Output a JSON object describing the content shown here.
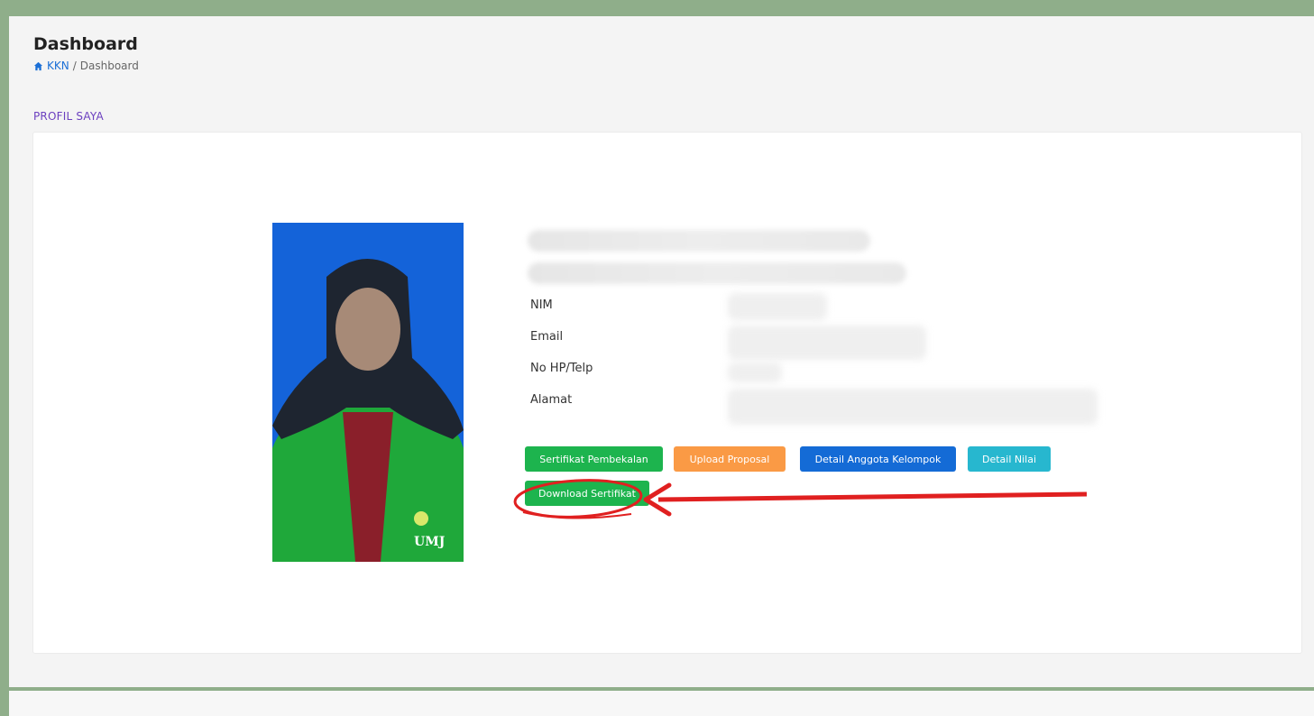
{
  "header": {
    "title": "Dashboard",
    "breadcrumb": {
      "root": "KKN",
      "separator": "/",
      "current": "Dashboard"
    }
  },
  "section": {
    "heading": "PROFIL SAYA"
  },
  "profile": {
    "photo_badge": "UMJ",
    "fields": [
      {
        "label": "NIM"
      },
      {
        "label": "Email"
      },
      {
        "label": "No HP/Telp"
      },
      {
        "label": "Alamat"
      }
    ]
  },
  "actions": {
    "sertifikat_pembekalan": "Sertifikat Pembekalan",
    "upload_proposal": "Upload Proposal",
    "detail_anggota": "Detail Anggota Kelompok",
    "detail_nilai": "Detail Nilai",
    "download_sertifikat": "Download Sertifikat"
  },
  "colors": {
    "green": "#1db44e",
    "orange": "#fa9a45",
    "blue": "#146bd6",
    "cyan": "#27b7cf",
    "annotation_red": "#e02020",
    "heading_purple": "#6b3fbf"
  }
}
